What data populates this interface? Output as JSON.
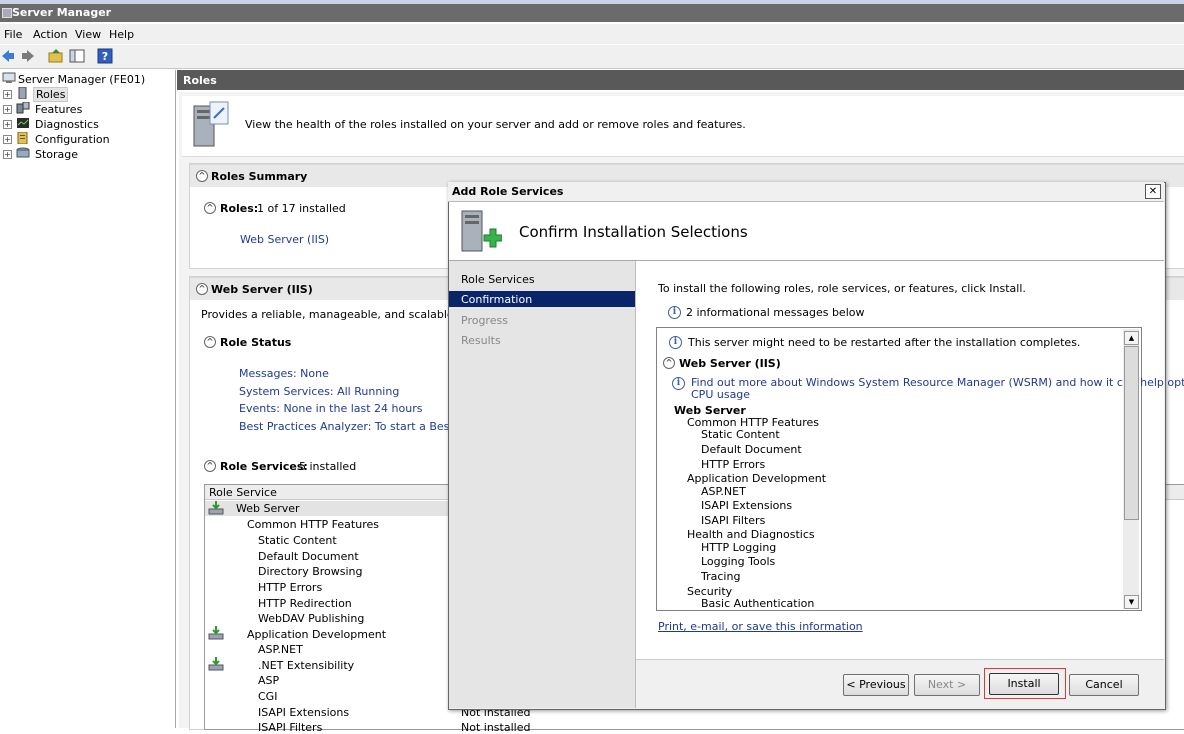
{
  "window": {
    "title": "Server Manager"
  },
  "menu": [
    "File",
    "Action",
    "View",
    "Help"
  ],
  "tree": {
    "root": "Server Manager (FE01)",
    "items": [
      "Roles",
      "Features",
      "Diagnostics",
      "Configuration",
      "Storage"
    ]
  },
  "main": {
    "header": "Roles",
    "description": "View the health of the roles installed on your server and add or remove roles and features.",
    "roles_summary": {
      "title": "Roles Summary",
      "roles_label": "Roles:",
      "roles_count": "1 of 17 installed",
      "role_link": "Web Server (IIS)"
    },
    "web_server": {
      "title": "Web Server (IIS)",
      "description": "Provides a reliable, manageable, and scalable Web appli",
      "role_status_title": "Role Status",
      "status_links": [
        "Messages: None",
        "System Services: All Running",
        "Events: None in the last 24 hours",
        "Best Practices Analyzer: To start a Best Practic"
      ],
      "role_services_title": "Role Services:",
      "role_services_count": "5 installed",
      "table_header": "Role Service",
      "rows": [
        "Web Server",
        "Common HTTP Features",
        "Static Content",
        "Default Document",
        "Directory Browsing",
        "HTTP Errors",
        "HTTP Redirection",
        "WebDAV Publishing",
        "Application Development",
        "ASP.NET",
        ".NET Extensibility",
        "ASP",
        "CGI",
        "ISAPI Extensions",
        "ISAPI Filters"
      ],
      "status_values": [
        "Not installed",
        "Not installed"
      ]
    }
  },
  "dialog": {
    "title": "Add Role Services",
    "close": "✕",
    "heading": "Confirm Installation Selections",
    "nav": [
      "Role Services",
      "Confirmation",
      "Progress",
      "Results"
    ],
    "instruction": "To install the following roles, role services, or features, click Install.",
    "info_count": "2 informational messages below",
    "messages": {
      "restart": "This server might need to be restarted after the installation completes.",
      "section": "Web Server (IIS)",
      "wsrm_line1": "Find out more about Windows System Resource Manager (WSRM) and how it can help optimize",
      "wsrm_line2": "CPU usage",
      "group": "Web Server",
      "items": [
        "Common HTTP Features",
        "Static Content",
        "Default Document",
        "HTTP Errors",
        "Application Development",
        "ASP.NET",
        "ISAPI Extensions",
        "ISAPI Filters",
        "Health and Diagnostics",
        "HTTP Logging",
        "Logging Tools",
        "Tracing",
        "Security",
        "Basic Authentication"
      ]
    },
    "print_link": "Print, e-mail, or save this information",
    "buttons": {
      "previous": "< Previous",
      "next": "Next >",
      "install": "Install",
      "cancel": "Cancel"
    }
  }
}
